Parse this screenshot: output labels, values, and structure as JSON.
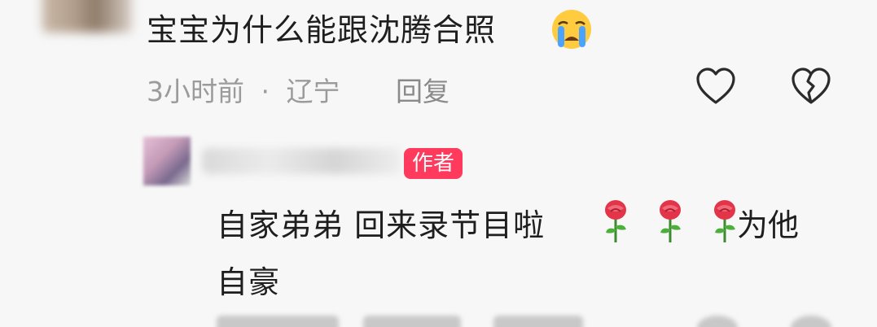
{
  "comment": {
    "text": "宝宝为什么能跟沈腾合照",
    "emoji": "crying-face",
    "meta": {
      "time": "3小时前",
      "separator": "·",
      "location": "辽宁"
    },
    "reply_label": "回复"
  },
  "author_reply": {
    "badge": "作者",
    "text_line1": "自家弟弟 回来录节目啦",
    "roses_count": 3,
    "text_tail": "为他",
    "text_line2": "自豪"
  },
  "colors": {
    "background": "#f7f7f7",
    "text": "#1e1e1e",
    "meta": "#9b9b9b",
    "badge_bg": "#ff3a5c",
    "badge_text": "#ffffff",
    "icon_stroke": "#2b2b2b"
  },
  "icons": [
    "heart-icon",
    "broken-heart-icon",
    "rose-emoji",
    "crying-face-emoji"
  ]
}
